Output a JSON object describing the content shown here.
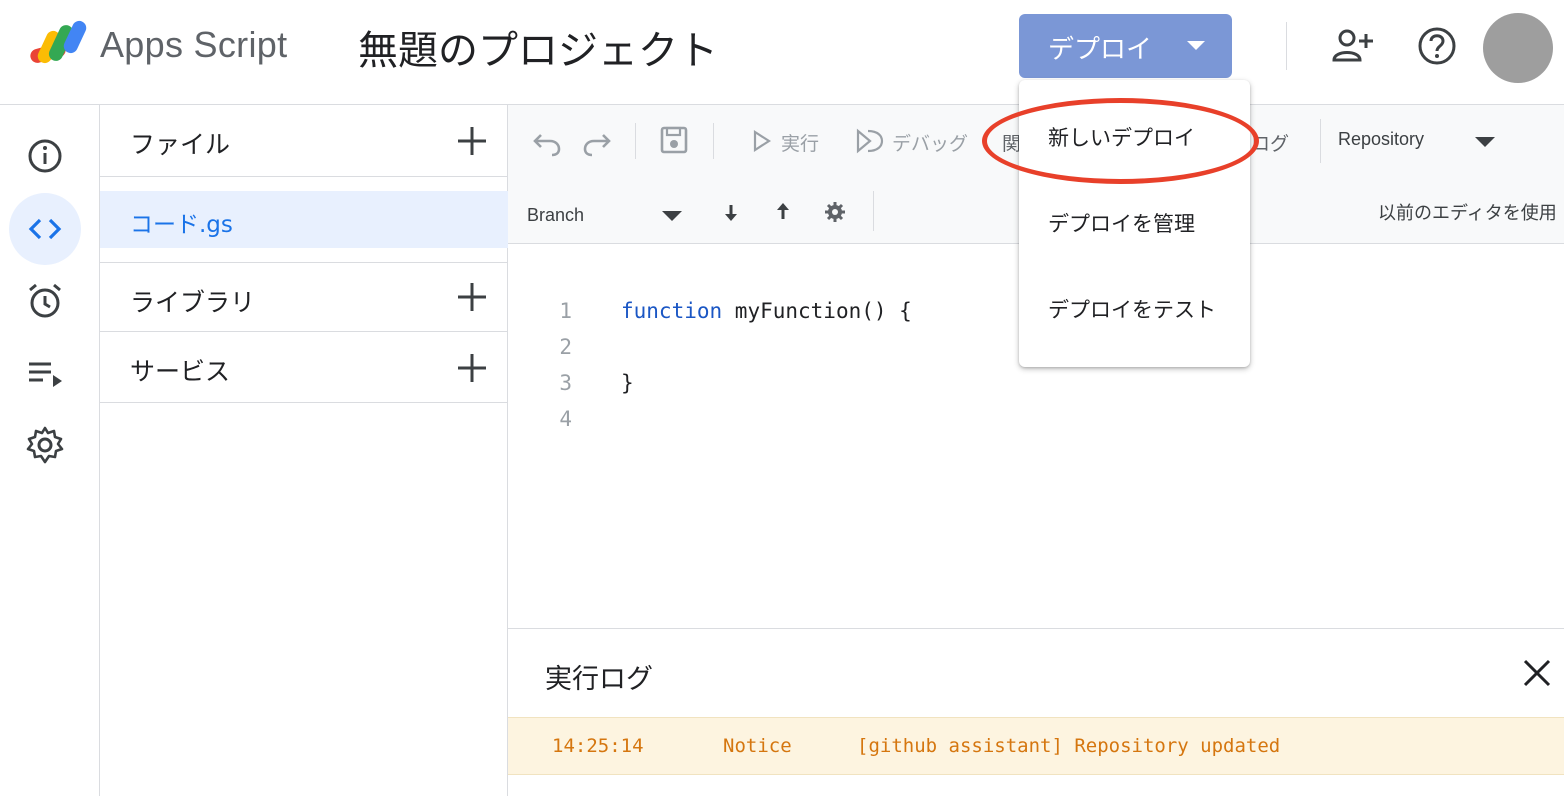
{
  "header": {
    "app_name": "Apps Script",
    "project_title": "無題のプロジェクト",
    "deploy_label": "デプロイ",
    "icons": [
      "add-person-icon",
      "help-icon",
      "avatar"
    ]
  },
  "rail": {
    "items": [
      {
        "name": "info-icon",
        "active": false
      },
      {
        "name": "code-icon",
        "active": true
      },
      {
        "name": "alarm-clock-icon",
        "active": false
      },
      {
        "name": "playlist-play-icon",
        "active": false
      },
      {
        "name": "gear-icon",
        "active": false
      }
    ]
  },
  "files_panel": {
    "files_label": "ファイル",
    "current_file": "コード.gs",
    "libraries_label": "ライブラリ",
    "services_label": "サービス"
  },
  "toolbar": {
    "run_label": "実行",
    "debug_label": "デバッグ",
    "function_label_partial": "関",
    "log_label_partial": "ログ",
    "repository_label": "Repository",
    "branch_label": "Branch",
    "legacy_editor_label": "以前のエディタを使用"
  },
  "code": {
    "line_numbers": [
      "1",
      "2",
      "3",
      "4"
    ],
    "line1_keyword": "function",
    "line1_rest": " myFunction() {",
    "line3": "}"
  },
  "log": {
    "title": "実行ログ",
    "entry_time": "14:25:14",
    "entry_level": "Notice",
    "entry_message": "[github assistant] Repository updated"
  },
  "deploy_menu": {
    "items": [
      "新しいデプロイ",
      "デプロイを管理",
      "デプロイをテスト"
    ]
  },
  "colors": {
    "deploy_button": "#7b97d6",
    "accent_blue": "#1a73e8",
    "highlight_ring": "#e8402a",
    "log_notice": "#d5760f"
  }
}
